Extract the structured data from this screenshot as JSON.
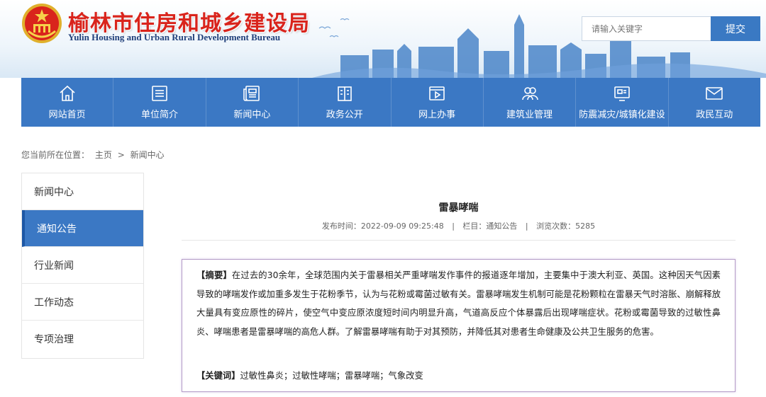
{
  "header": {
    "title": "榆林市住房和城乡建设局",
    "subtitle": "Yulin Housing and Urban Rural Development Bureau",
    "search_placeholder": "请输入关键字",
    "search_button": "提交"
  },
  "nav": {
    "items": [
      {
        "label": "网站首页",
        "icon": "home-icon"
      },
      {
        "label": "单位简介",
        "icon": "list-icon"
      },
      {
        "label": "新闻中心",
        "icon": "news-icon"
      },
      {
        "label": "政务公开",
        "icon": "building-icon"
      },
      {
        "label": "网上办事",
        "icon": "play-icon"
      },
      {
        "label": "建筑业管理",
        "icon": "users-icon"
      },
      {
        "label": "防震减灾/城镇化建设",
        "icon": "monitor-icon"
      },
      {
        "label": "政民互动",
        "icon": "mail-icon"
      }
    ]
  },
  "breadcrumb": {
    "prefix": "您当前所在位置：",
    "home": "主页",
    "separator": ">",
    "current": "新闻中心"
  },
  "sidebar": {
    "items": [
      {
        "label": "新闻中心",
        "active": false
      },
      {
        "label": "通知公告",
        "active": true
      },
      {
        "label": "行业新闻",
        "active": false
      },
      {
        "label": "工作动态",
        "active": false
      },
      {
        "label": "专项治理",
        "active": false
      }
    ]
  },
  "article": {
    "title": "雷暴哮喘",
    "publish_label": "发布时间：",
    "publish_time": "2022-09-09 09:25:48",
    "column_label": "栏目：",
    "column": "通知公告",
    "views_label": "浏览次数：",
    "views": "5285",
    "meta_separator": "|",
    "abstract_label": "【摘要】",
    "abstract": "在过去的30余年，全球范围内关于雷暴相关严重哮喘发作事件的报道逐年增加，主要集中于澳大利亚、英国。这种因天气因素导致的哮喘发作或加重多发生于花粉季节，认为与花粉或霉菌过敏有关。雷暴哮喘发生机制可能是花粉颗粒在雷暴天气时溶胀、崩解释放大量具有变应原性的碎片，使空气中变应原浓度短时间内明显升高，气道高反应个体暴露后出现哮喘症状。花粉或霉菌导致的过敏性鼻炎、哮喘患者是雷暴哮喘的高危人群。了解雷暴哮喘有助于对其预防，并降低其对患者生命健康及公共卫生服务的危害。",
    "keywords_label": "【关键词】",
    "keywords": "过敏性鼻炎；过敏性哮喘；雷暴哮喘；气象改变"
  },
  "colors": {
    "brand_blue": "#3b78c4",
    "title_red": "#d9241c",
    "abstract_border": "#b59cc8"
  }
}
